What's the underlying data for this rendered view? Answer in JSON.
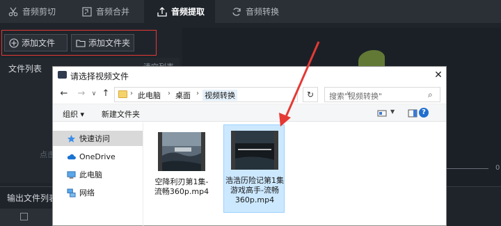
{
  "tabs": [
    {
      "label": "音频剪切",
      "icon": "scissors-icon"
    },
    {
      "label": "音频合并",
      "icon": "merge-icon"
    },
    {
      "label": "音频提取",
      "icon": "export-icon",
      "active": true
    },
    {
      "label": "音频转换",
      "icon": "refresh-icon"
    }
  ],
  "toolbar": {
    "add_file": "添加文件",
    "add_folder": "添加文件夹"
  },
  "left_panel": {
    "file_list_label": "文件列表",
    "clear_list": "清空列表",
    "hint": "点击"
  },
  "output": {
    "label": "输出文件列表",
    "time_text": "0"
  },
  "dialog": {
    "title": "请选择视频文件",
    "breadcrumb": [
      "此电脑",
      "桌面",
      "视频转换"
    ],
    "search_placeholder": "搜索\"视频转换\"",
    "organize": "组织",
    "new_folder": "新建文件夹",
    "help": "?",
    "nav": [
      {
        "label": "快速访问",
        "icon": "star-icon",
        "selected": true
      },
      {
        "label": "OneDrive",
        "icon": "cloud-icon"
      },
      {
        "label": "此电脑",
        "icon": "computer-icon"
      },
      {
        "label": "网络",
        "icon": "network-icon"
      }
    ],
    "files": [
      {
        "name": "空降利刃第1集-流畅360p.mp4",
        "line1": "空降利刃第1集-",
        "line2": "流畅360p.mp4",
        "selected": false
      },
      {
        "name": "浩浩历险记第1集游戏高手-流畅360p.mp4",
        "line1": "浩浩历险记第1集",
        "line2": "游戏高手-流畅",
        "line3": "360p.mp4",
        "selected": true
      }
    ]
  },
  "colors": {
    "app_bg": "#1f242b",
    "highlight_red": "#e53935",
    "selection_blue": "#cce8ff"
  }
}
